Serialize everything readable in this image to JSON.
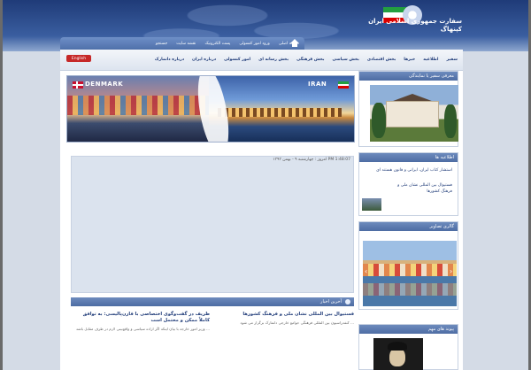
{
  "header": {
    "title_line1": "سفارت جمهوری اسلامی ایران",
    "title_line2": "کپنهاگ"
  },
  "topnav": {
    "items": [
      "صفحه اصلی",
      "ورود امور کنسولی",
      "پست الکترونیک",
      "نقشه سایت",
      "جستجو"
    ]
  },
  "menu": {
    "items": [
      "سفیر",
      "اطلاعیه",
      "خبرها",
      "بخش اقتصادی",
      "بخش سیاسی",
      "بخش فرهنگی",
      "بخش رسانه ای",
      "امور کنسولی",
      "درباره ایران",
      "درباره دانمارک"
    ],
    "english_label": "English"
  },
  "banner": {
    "left_label": "DENMARK",
    "right_label": "IRAN"
  },
  "main": {
    "date": "امروز : چهارشنبه ۹ - بهمن ۱۳۹۳  PM 1:48:07"
  },
  "news": {
    "header": "آخرین اخبار",
    "col_right_title": "فستیوال بین المللی نشان ملی و فرهنگ کشورها",
    "col_right_body": "کنفدراسیون بین المللی فرهنگی جوامع خارجی دانمارک برگزار می شود ...",
    "col_left_title": "ظریف در گفت‌وگوی اختصاصی با فارن‌پالیسی: به توافق کاملاً ممکن و محتمل است",
    "col_left_body": "وزیر امور خارجه با بیان اینکه اگر اراده سیاسی و واقع‌بینی لازم در طرف مقابل باشد ..."
  },
  "sidebar": {
    "ambassador_header": "معرفی سفیر یا نمایندگی",
    "notices_header": "اطلاعیه ها",
    "notice1": "استشار کتاب ایران، ایرانی و قانون هستند ای",
    "notice2": "فستیوال بین المللی نشان ملی و فرهنگ کشورها",
    "gallery_header": "گالری تصاویر",
    "links_header": "پیوند های مهم"
  }
}
